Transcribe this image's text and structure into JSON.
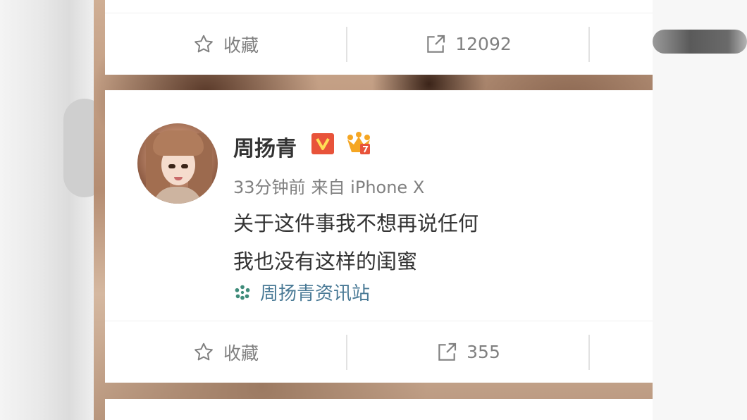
{
  "top_card": {
    "favorite_label": "收藏",
    "repost_count": "12092"
  },
  "post": {
    "username": "周扬青",
    "verified_icon": "verified-v-badge",
    "vip_icon": "vip-crown-icon",
    "time": "33分钟前",
    "source": "来自 iPhone X",
    "content_lines": [
      "关于这件事我不想再说任何",
      "我也没有这样的闺蜜"
    ],
    "topic": "周扬青资讯站",
    "favorite_label": "收藏",
    "repost_count": "355"
  },
  "colors": {
    "accent_link": "#4a7a96",
    "verified_badge": "#e8533a",
    "vip_crown": "#f5a623"
  }
}
